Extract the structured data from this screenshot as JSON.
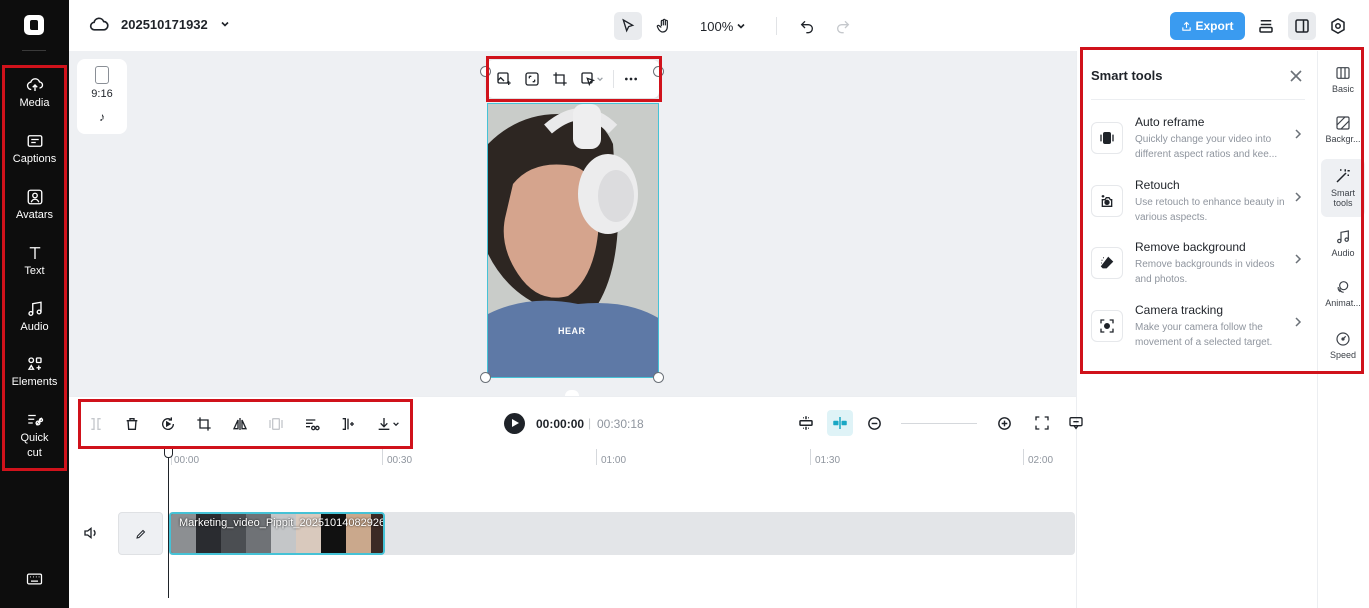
{
  "project": {
    "name": "202510171932"
  },
  "left_nav": [
    {
      "label": "Media",
      "icon": "upload-cloud-icon"
    },
    {
      "label": "Captions",
      "icon": "captions-icon"
    },
    {
      "label": "Avatars",
      "icon": "avatar-icon"
    },
    {
      "label": "Text",
      "icon": "text-icon"
    },
    {
      "label": "Audio",
      "icon": "music-note-icon"
    },
    {
      "label": "Elements",
      "icon": "elements-icon"
    },
    {
      "label": "Quick",
      "label2": "cut",
      "icon": "scissors-icon"
    }
  ],
  "top_bar": {
    "zoom": "100%",
    "export_label": "Export"
  },
  "canvas": {
    "ratio": "9:16",
    "platform_icon": "tiktok-icon",
    "caption_word": "HEAR"
  },
  "smart_tools": {
    "title": "Smart tools",
    "items": [
      {
        "name": "Auto reframe",
        "desc": "Quickly change your video into different aspect ratios and kee...",
        "icon": "reframe-icon"
      },
      {
        "name": "Retouch",
        "desc": "Use retouch to enhance beauty in various aspects.",
        "icon": "retouch-icon"
      },
      {
        "name": "Remove background",
        "desc": "Remove backgrounds in videos and photos.",
        "icon": "eraser-icon"
      },
      {
        "name": "Camera tracking",
        "desc": "Make your camera follow the movement of a selected target.",
        "icon": "camera-tracking-icon"
      }
    ]
  },
  "right_nav": [
    {
      "label": "Basic",
      "icon": "basic-icon"
    },
    {
      "label": "Backgr...",
      "icon": "background-icon"
    },
    {
      "label": "Smart",
      "label2": "tools",
      "icon": "magic-wand-icon"
    },
    {
      "label": "Audio",
      "icon": "music-note-icon"
    },
    {
      "label": "Animat...",
      "icon": "animation-icon"
    },
    {
      "label": "Speed",
      "icon": "speed-icon"
    }
  ],
  "playback": {
    "current": "00:00:00",
    "separator": "|",
    "total": "00:30:18"
  },
  "ruler": [
    "00:00",
    "00:30",
    "01:00",
    "01:30",
    "02:00"
  ],
  "clip": {
    "name": "Marketing_video_Pippit_20251014082926"
  }
}
